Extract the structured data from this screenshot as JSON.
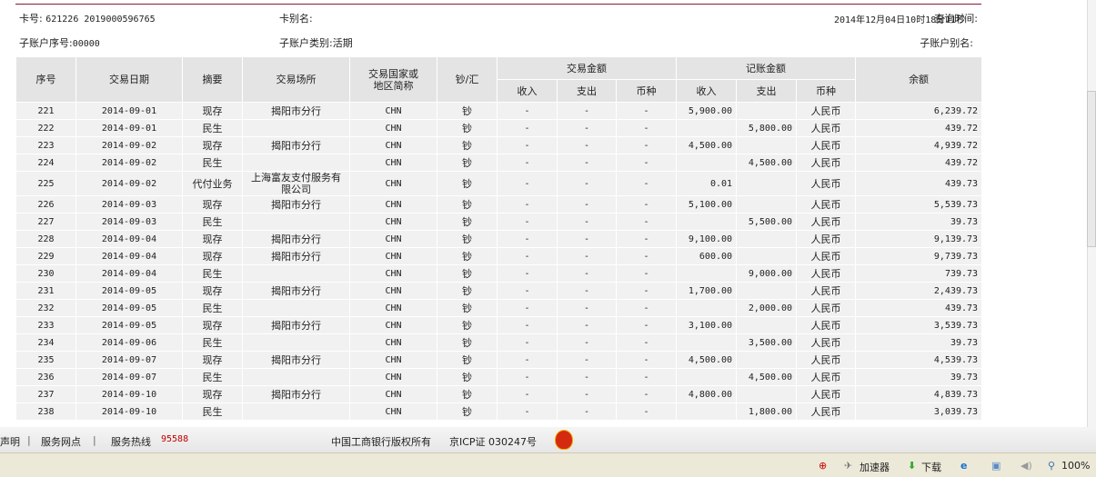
{
  "header": {
    "card_no_label": "卡号:",
    "card_no": "621226 2019000596765",
    "card_alias_label": "卡别名:",
    "query_time_label": "查询时间:",
    "query_time": "2014年12月04日10时18分11秒",
    "sub_account_no_label": "子账户序号:",
    "sub_account_no": "00000",
    "sub_account_type_label": "子账户类别:",
    "sub_account_type": "活期",
    "sub_account_alias_label": "子账户别名:"
  },
  "table": {
    "headers": {
      "seq": "序号",
      "date": "交易日期",
      "summary": "摘要",
      "place": "交易场所",
      "country_1": "交易国家或",
      "country_2": "地区简称",
      "cash": "钞/汇",
      "trade_amount": "交易金额",
      "book_amount": "记账金额",
      "balance": "余额",
      "income": "收入",
      "expense": "支出",
      "currency": "币种"
    },
    "rows": [
      {
        "seq": "221",
        "date": "2014-09-01",
        "summary": "现存",
        "place": "揭阳市分行",
        "country": "CHN",
        "cash": "钞",
        "t_in": "-",
        "t_out": "-",
        "t_cur": "-",
        "b_in": "5,900.00",
        "b_out": "",
        "b_cur": "人民币",
        "balance": "6,239.72"
      },
      {
        "seq": "222",
        "date": "2014-09-01",
        "summary": "民生",
        "place": "",
        "country": "CHN",
        "cash": "钞",
        "t_in": "-",
        "t_out": "-",
        "t_cur": "-",
        "b_in": "",
        "b_out": "5,800.00",
        "b_cur": "人民币",
        "balance": "439.72"
      },
      {
        "seq": "223",
        "date": "2014-09-02",
        "summary": "现存",
        "place": "揭阳市分行",
        "country": "CHN",
        "cash": "钞",
        "t_in": "-",
        "t_out": "-",
        "t_cur": "-",
        "b_in": "4,500.00",
        "b_out": "",
        "b_cur": "人民币",
        "balance": "4,939.72"
      },
      {
        "seq": "224",
        "date": "2014-09-02",
        "summary": "民生",
        "place": "",
        "country": "CHN",
        "cash": "钞",
        "t_in": "-",
        "t_out": "-",
        "t_cur": "-",
        "b_in": "",
        "b_out": "4,500.00",
        "b_cur": "人民币",
        "balance": "439.72"
      },
      {
        "seq": "225",
        "date": "2014-09-02",
        "summary": "代付业务",
        "place": "上海富友支付服务有限公司",
        "country": "CHN",
        "cash": "钞",
        "t_in": "-",
        "t_out": "-",
        "t_cur": "-",
        "b_in": "0.01",
        "b_out": "",
        "b_cur": "人民币",
        "balance": "439.73"
      },
      {
        "seq": "226",
        "date": "2014-09-03",
        "summary": "现存",
        "place": "揭阳市分行",
        "country": "CHN",
        "cash": "钞",
        "t_in": "-",
        "t_out": "-",
        "t_cur": "-",
        "b_in": "5,100.00",
        "b_out": "",
        "b_cur": "人民币",
        "balance": "5,539.73"
      },
      {
        "seq": "227",
        "date": "2014-09-03",
        "summary": "民生",
        "place": "",
        "country": "CHN",
        "cash": "钞",
        "t_in": "-",
        "t_out": "-",
        "t_cur": "-",
        "b_in": "",
        "b_out": "5,500.00",
        "b_cur": "人民币",
        "balance": "39.73"
      },
      {
        "seq": "228",
        "date": "2014-09-04",
        "summary": "现存",
        "place": "揭阳市分行",
        "country": "CHN",
        "cash": "钞",
        "t_in": "-",
        "t_out": "-",
        "t_cur": "-",
        "b_in": "9,100.00",
        "b_out": "",
        "b_cur": "人民币",
        "balance": "9,139.73"
      },
      {
        "seq": "229",
        "date": "2014-09-04",
        "summary": "现存",
        "place": "揭阳市分行",
        "country": "CHN",
        "cash": "钞",
        "t_in": "-",
        "t_out": "-",
        "t_cur": "-",
        "b_in": "600.00",
        "b_out": "",
        "b_cur": "人民币",
        "balance": "9,739.73"
      },
      {
        "seq": "230",
        "date": "2014-09-04",
        "summary": "民生",
        "place": "",
        "country": "CHN",
        "cash": "钞",
        "t_in": "-",
        "t_out": "-",
        "t_cur": "-",
        "b_in": "",
        "b_out": "9,000.00",
        "b_cur": "人民币",
        "balance": "739.73"
      },
      {
        "seq": "231",
        "date": "2014-09-05",
        "summary": "现存",
        "place": "揭阳市分行",
        "country": "CHN",
        "cash": "钞",
        "t_in": "-",
        "t_out": "-",
        "t_cur": "-",
        "b_in": "1,700.00",
        "b_out": "",
        "b_cur": "人民币",
        "balance": "2,439.73"
      },
      {
        "seq": "232",
        "date": "2014-09-05",
        "summary": "民生",
        "place": "",
        "country": "CHN",
        "cash": "钞",
        "t_in": "-",
        "t_out": "-",
        "t_cur": "-",
        "b_in": "",
        "b_out": "2,000.00",
        "b_cur": "人民币",
        "balance": "439.73"
      },
      {
        "seq": "233",
        "date": "2014-09-05",
        "summary": "现存",
        "place": "揭阳市分行",
        "country": "CHN",
        "cash": "钞",
        "t_in": "-",
        "t_out": "-",
        "t_cur": "-",
        "b_in": "3,100.00",
        "b_out": "",
        "b_cur": "人民币",
        "balance": "3,539.73"
      },
      {
        "seq": "234",
        "date": "2014-09-06",
        "summary": "民生",
        "place": "",
        "country": "CHN",
        "cash": "钞",
        "t_in": "-",
        "t_out": "-",
        "t_cur": "-",
        "b_in": "",
        "b_out": "3,500.00",
        "b_cur": "人民币",
        "balance": "39.73"
      },
      {
        "seq": "235",
        "date": "2014-09-07",
        "summary": "现存",
        "place": "揭阳市分行",
        "country": "CHN",
        "cash": "钞",
        "t_in": "-",
        "t_out": "-",
        "t_cur": "-",
        "b_in": "4,500.00",
        "b_out": "",
        "b_cur": "人民币",
        "balance": "4,539.73"
      },
      {
        "seq": "236",
        "date": "2014-09-07",
        "summary": "民生",
        "place": "",
        "country": "CHN",
        "cash": "钞",
        "t_in": "-",
        "t_out": "-",
        "t_cur": "-",
        "b_in": "",
        "b_out": "4,500.00",
        "b_cur": "人民币",
        "balance": "39.73"
      },
      {
        "seq": "237",
        "date": "2014-09-10",
        "summary": "现存",
        "place": "揭阳市分行",
        "country": "CHN",
        "cash": "钞",
        "t_in": "-",
        "t_out": "-",
        "t_cur": "-",
        "b_in": "4,800.00",
        "b_out": "",
        "b_cur": "人民币",
        "balance": "4,839.73"
      },
      {
        "seq": "238",
        "date": "2014-09-10",
        "summary": "民生",
        "place": "",
        "country": "CHN",
        "cash": "钞",
        "t_in": "-",
        "t_out": "-",
        "t_cur": "-",
        "b_in": "",
        "b_out": "1,800.00",
        "b_cur": "人民币",
        "balance": "3,039.73"
      }
    ]
  },
  "footer": {
    "statement": "声明",
    "sep": "|",
    "outlets": "服务网点",
    "hotline_label": "服务热线",
    "hotline": "95588",
    "copyright": "中国工商银行版权所有",
    "icp": "京ICP证 030247号",
    "hotline_color": "#c00000"
  },
  "statusbar": {
    "accelerator": "加速器",
    "download": "下载",
    "zoom": "100%"
  }
}
